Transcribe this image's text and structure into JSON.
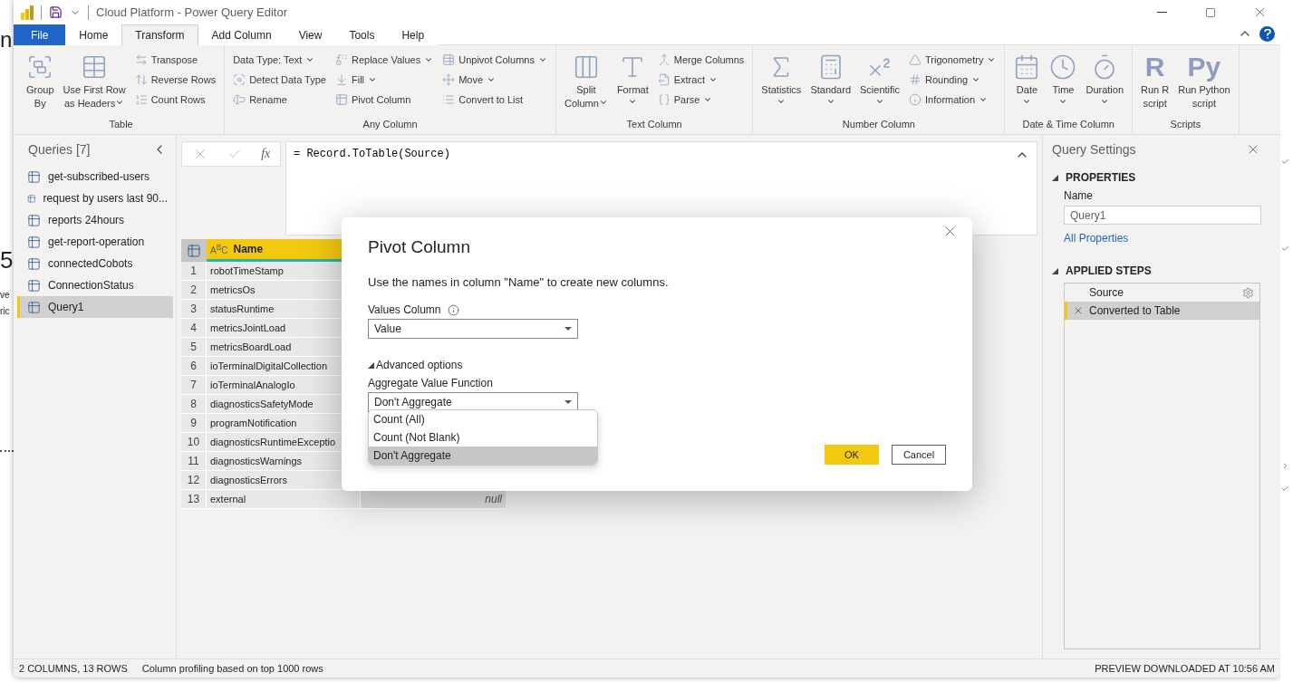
{
  "background_app": {
    "texts": [
      "n",
      "5",
      "ve",
      "ric"
    ]
  },
  "window": {
    "title": "Cloud Platform - Power Query Editor"
  },
  "tabs": [
    {
      "label": "File",
      "kind": "file",
      "selected": false
    },
    {
      "label": "Home",
      "kind": "tab",
      "selected": false
    },
    {
      "label": "Transform",
      "kind": "tab",
      "selected": true
    },
    {
      "label": "Add Column",
      "kind": "tab",
      "selected": false
    },
    {
      "label": "View",
      "kind": "tab",
      "selected": false
    },
    {
      "label": "Tools",
      "kind": "tab",
      "selected": false
    },
    {
      "label": "Help",
      "kind": "tab",
      "selected": false
    }
  ],
  "ribbon": {
    "groups": [
      {
        "label": "Table",
        "items": [
          {
            "kind": "large",
            "lines": [
              "Group",
              "By"
            ],
            "dropdown": false
          },
          {
            "kind": "large",
            "lines": [
              "Use First Row",
              "as Headers"
            ],
            "dropdown": true
          },
          {
            "kind": "stack",
            "buttons": [
              {
                "label": "Transpose",
                "dropdown": false
              },
              {
                "label": "Reverse Rows",
                "dropdown": false
              },
              {
                "label": "Count Rows",
                "dropdown": false
              }
            ]
          }
        ]
      },
      {
        "label": "Any Column",
        "items": [
          {
            "kind": "stack",
            "buttons": [
              {
                "label": "Data Type: Text",
                "dropdown": true
              },
              {
                "label": "Detect Data Type",
                "dropdown": false
              },
              {
                "label": "Rename",
                "dropdown": false
              }
            ]
          },
          {
            "kind": "stack",
            "buttons": [
              {
                "label": "Replace Values",
                "dropdown": true
              },
              {
                "label": "Fill",
                "dropdown": true
              },
              {
                "label": "Pivot Column",
                "dropdown": false
              }
            ]
          },
          {
            "kind": "stack",
            "buttons": [
              {
                "label": "Unpivot Columns",
                "dropdown": true
              },
              {
                "label": "Move",
                "dropdown": true
              },
              {
                "label": "Convert to List",
                "dropdown": false
              }
            ]
          }
        ]
      },
      {
        "label": "Text Column",
        "items": [
          {
            "kind": "large",
            "lines": [
              "Split",
              "Column"
            ],
            "dropdown": true
          },
          {
            "kind": "large",
            "lines": [
              "Format"
            ],
            "dropdown": true
          },
          {
            "kind": "stack",
            "buttons": [
              {
                "label": "Merge Columns",
                "dropdown": false
              },
              {
                "label": "Extract",
                "dropdown": true
              },
              {
                "label": "Parse",
                "dropdown": true
              }
            ]
          }
        ]
      },
      {
        "label": "Number Column",
        "items": [
          {
            "kind": "large",
            "lines": [
              "Statistics"
            ],
            "dropdown": true
          },
          {
            "kind": "large",
            "lines": [
              "Standard"
            ],
            "dropdown": true
          },
          {
            "kind": "large",
            "lines": [
              "Scientific"
            ],
            "dropdown": true
          },
          {
            "kind": "stack",
            "buttons": [
              {
                "label": "Trigonometry",
                "dropdown": true
              },
              {
                "label": "Rounding",
                "dropdown": true
              },
              {
                "label": "Information",
                "dropdown": true
              }
            ]
          }
        ]
      },
      {
        "label": "Date & Time Column",
        "items": [
          {
            "kind": "large",
            "lines": [
              "Date"
            ],
            "dropdown": true
          },
          {
            "kind": "large",
            "lines": [
              "Time"
            ],
            "dropdown": true
          },
          {
            "kind": "large",
            "lines": [
              "Duration"
            ],
            "dropdown": true
          }
        ]
      },
      {
        "label": "Scripts",
        "items": [
          {
            "kind": "glyph",
            "glyph": "R",
            "lines": [
              "Run R",
              "script"
            ],
            "dropdown": false
          },
          {
            "kind": "glyph",
            "glyph": "Py",
            "lines": [
              "Run Python",
              "script"
            ],
            "dropdown": false
          }
        ]
      }
    ]
  },
  "queries": {
    "title": "Queries [7]",
    "items": [
      {
        "label": "get-subscribed-users",
        "selected": false
      },
      {
        "label": "request by users last 90...",
        "selected": false
      },
      {
        "label": "reports 24hours",
        "selected": false
      },
      {
        "label": "get-report-operation",
        "selected": false
      },
      {
        "label": "connectedCobots",
        "selected": false
      },
      {
        "label": "ConnectionStatus",
        "selected": false
      },
      {
        "label": "Query1",
        "selected": true
      }
    ]
  },
  "formula_bar": {
    "function_label": "fx",
    "formula": "= Record.ToTable(Source)"
  },
  "table": {
    "columns": [
      {
        "type_glyph": "A$^{B}$C",
        "label": "Name"
      }
    ],
    "rows": [
      {
        "index": "1",
        "name": "robotTimeStamp"
      },
      {
        "index": "2",
        "name": "metricsOs"
      },
      {
        "index": "3",
        "name": "statusRuntime"
      },
      {
        "index": "4",
        "name": "metricsJointLoad"
      },
      {
        "index": "5",
        "name": "metricsBoardLoad"
      },
      {
        "index": "6",
        "name": "ioTerminalDigitalCollection"
      },
      {
        "index": "7",
        "name": "ioTerminalAnalogIo"
      },
      {
        "index": "8",
        "name": "diagnosticsSafetyMode"
      },
      {
        "index": "9",
        "name": "programNotification"
      },
      {
        "index": "10",
        "name": "diagnosticsRuntimeExceptio"
      },
      {
        "index": "11",
        "name": "diagnosticsWarnings"
      },
      {
        "index": "12",
        "name": "diagnosticsErrors"
      },
      {
        "index": "13",
        "name": "external",
        "value": "null"
      }
    ]
  },
  "query_settings": {
    "title": "Query Settings",
    "properties": {
      "heading": "PROPERTIES",
      "expanded": true,
      "name_label": "Name",
      "name_value": "Query1",
      "link": "All Properties"
    },
    "applied_steps": {
      "heading": "APPLIED STEPS",
      "expanded": true,
      "steps": [
        {
          "label": "Source",
          "selected": false,
          "has_settings": true
        },
        {
          "label": "Converted to Table",
          "selected": true,
          "has_settings": false
        }
      ]
    }
  },
  "dialog": {
    "title": "Pivot Column",
    "description": "Use the names in column \"Name\" to create new columns.",
    "values_label": "Values Column",
    "values_value": "Value",
    "advanced": {
      "label": "Advanced options",
      "expanded": true
    },
    "aggregate_label": "Aggregate Value Function",
    "aggregate_value": "Don't Aggregate",
    "options": [
      {
        "label": "Count (All)",
        "selected": false
      },
      {
        "label": "Count (Not Blank)",
        "selected": false
      },
      {
        "label": "Don't Aggregate",
        "selected": true
      }
    ],
    "buttons": [
      {
        "label": "OK",
        "kind": "primary"
      },
      {
        "label": "Cancel",
        "kind": "secondary"
      }
    ]
  },
  "status_bar": {
    "left": [
      "2 COLUMNS, 13 ROWS",
      "Column profiling based on top 1000 rows"
    ],
    "right": "PREVIEW DOWNLOADED AT 10:56 AM"
  }
}
